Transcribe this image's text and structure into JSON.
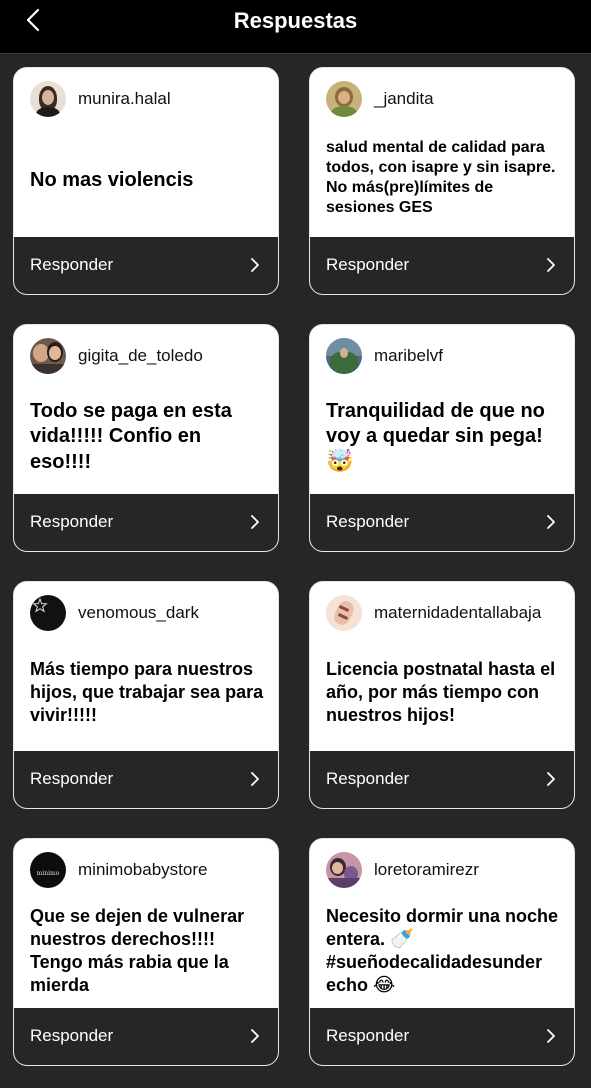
{
  "header": {
    "title": "Respuestas",
    "back_icon": "chevron-left-icon"
  },
  "cards": [
    {
      "username": "munira.halal",
      "message": "No mas violencis",
      "action": "Responder",
      "avatar_color": "#c9b7a3"
    },
    {
      "username": "_jandita",
      "message": " salud mental de calidad para todos, con isapre y sin isapre. No más(pre)límites de sesiones GES",
      "action": "Responder",
      "avatar_color": "#a8925c"
    },
    {
      "username": "gigita_de_toledo",
      "message": "Todo se paga en esta vida!!!!! Confio en eso!!!!",
      "action": "Responder",
      "avatar_color": "#5a4536"
    },
    {
      "username": "maribelvf",
      "message": "Tranquilidad de que no voy a quedar sin pega!",
      "emoji": "🤯",
      "action": "Responder",
      "avatar_color": "#4d6b5a"
    },
    {
      "username": "venomous_dark",
      "message": "Más tiempo para nuestros hijos, que trabajar sea para vivir!!!!!",
      "action": "Responder",
      "avatar_color": "#111111"
    },
    {
      "username": "maternidadentallabaja",
      "message": "Licencia postnatal hasta el año, por más tiempo con nuestros hijos!",
      "action": "Responder",
      "avatar_color": "#f3d9c8"
    },
    {
      "username": "minimobabystore",
      "message": "Que se dejen de vulnerar nuestros derechos!!!! Tengo más rabia que la mierda",
      "action": "Responder",
      "avatar_color": "#0d0d0d",
      "avatar_text": "minimo"
    },
    {
      "username": "loretoramirezr",
      "message": "Necesito dormir una noche entera.",
      "emoji": "🍼",
      "message2": "#sueñodecalidadesunder echo",
      "emoji2": "😂",
      "action": "Responder",
      "avatar_color": "#b07a8c"
    }
  ]
}
